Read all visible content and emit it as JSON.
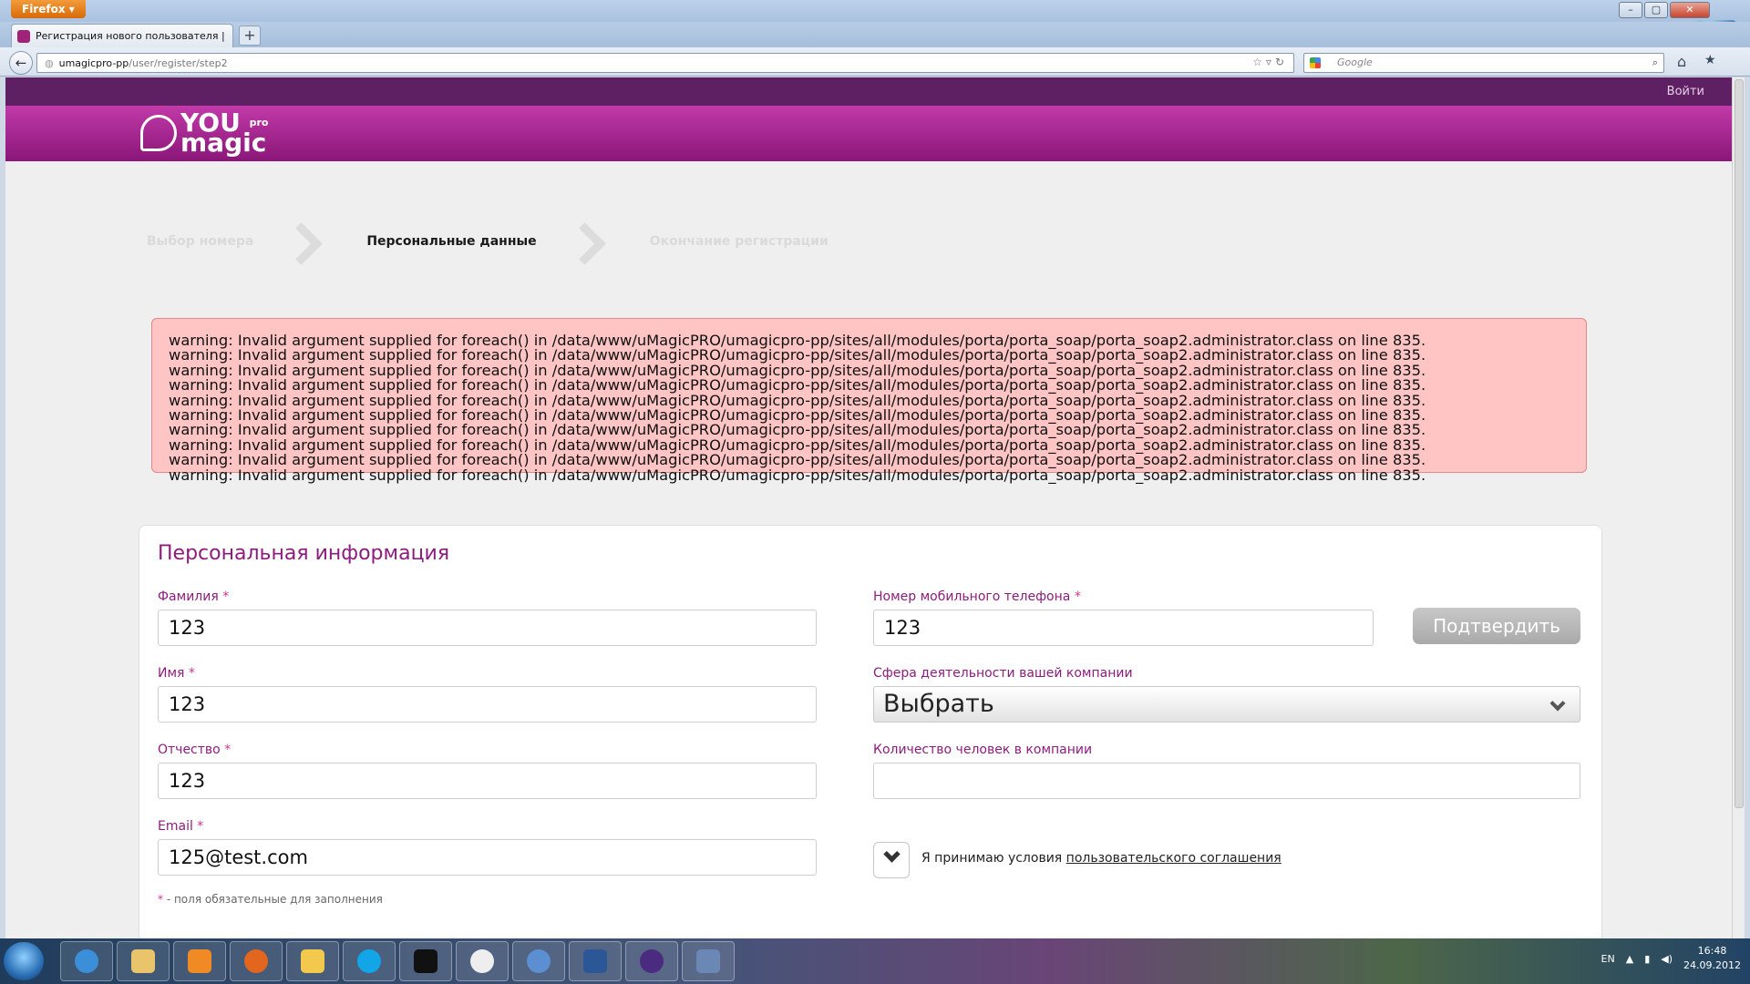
{
  "browser": {
    "menu_label": "Firefox",
    "tab_title": "Регистрация нового пользователя | Y...",
    "new_tab_label": "+",
    "url_host": "umagicpro-pp",
    "url_path": "/user/register/step2",
    "search_placeholder": "Google",
    "window_buttons": [
      "–",
      "▢",
      "✕"
    ]
  },
  "site": {
    "login_label": "Войти",
    "logo_word_top": "YOU",
    "logo_word_bottom": "magic",
    "logo_pro": "pro"
  },
  "steps": [
    {
      "label": "Выбор номера",
      "state": "done"
    },
    {
      "label": "Персональные данные",
      "state": "active"
    },
    {
      "label": "Окончание регистрации",
      "state": "pending"
    }
  ],
  "error": {
    "lines": [
      "warning: Invalid argument supplied for foreach() in /data/www/uMagicPRO/umagicpro-pp/sites/all/modules/porta/porta_soap/porta_soap2.administrator.class on line 835.",
      "warning: Invalid argument supplied for foreach() in /data/www/uMagicPRO/umagicpro-pp/sites/all/modules/porta/porta_soap/porta_soap2.administrator.class on line 835.",
      "warning: Invalid argument supplied for foreach() in /data/www/uMagicPRO/umagicpro-pp/sites/all/modules/porta/porta_soap/porta_soap2.administrator.class on line 835.",
      "warning: Invalid argument supplied for foreach() in /data/www/uMagicPRO/umagicpro-pp/sites/all/modules/porta/porta_soap/porta_soap2.administrator.class on line 835.",
      "warning: Invalid argument supplied for foreach() in /data/www/uMagicPRO/umagicpro-pp/sites/all/modules/porta/porta_soap/porta_soap2.administrator.class on line 835.",
      "warning: Invalid argument supplied for foreach() in /data/www/uMagicPRO/umagicpro-pp/sites/all/modules/porta/porta_soap/porta_soap2.administrator.class on line 835.",
      "warning: Invalid argument supplied for foreach() in /data/www/uMagicPRO/umagicpro-pp/sites/all/modules/porta/porta_soap/porta_soap2.administrator.class on line 835.",
      "warning: Invalid argument supplied for foreach() in /data/www/uMagicPRO/umagicpro-pp/sites/all/modules/porta/porta_soap/porta_soap2.administrator.class on line 835.",
      "warning: Invalid argument supplied for foreach() in /data/www/uMagicPRO/umagicpro-pp/sites/all/modules/porta/porta_soap/porta_soap2.administrator.class on line 835.",
      "warning: Invalid argument supplied for foreach() in /data/www/uMagicPRO/umagicpro-pp/sites/all/modules/porta/porta_soap/porta_soap2.administrator.class on line 835."
    ]
  },
  "form": {
    "title": "Персональная информация",
    "required_mark": "*",
    "last_name": {
      "label": "Фамилия",
      "value": "123"
    },
    "first_name": {
      "label": "Имя",
      "value": "123"
    },
    "middle_name": {
      "label": "Отчество",
      "value": "123"
    },
    "email": {
      "label": "Email",
      "value": "125@test.com"
    },
    "phone": {
      "label": "Номер мобильного телефона",
      "value": "123"
    },
    "confirm_label": "Подтвердить",
    "industry": {
      "label": "Сфера деятельности вашей компании",
      "value": "Выбрать"
    },
    "employees": {
      "label": "Количество человек в компании",
      "value": ""
    },
    "agree_text": "Я принимаю условия",
    "agree_link": "пользовательского соглашения",
    "hint_star": "*",
    "hint_text": " - поля обязательные для заполнения"
  },
  "taskbar": {
    "lang": "EN",
    "time": "16:48",
    "date": "24.09.2012"
  },
  "colors": {
    "brand": "#8e1b7e",
    "error_bg": "#ffc4c4",
    "confirm_bg": "#b5b5b5",
    "submit_bg": "#1d8b3a"
  }
}
